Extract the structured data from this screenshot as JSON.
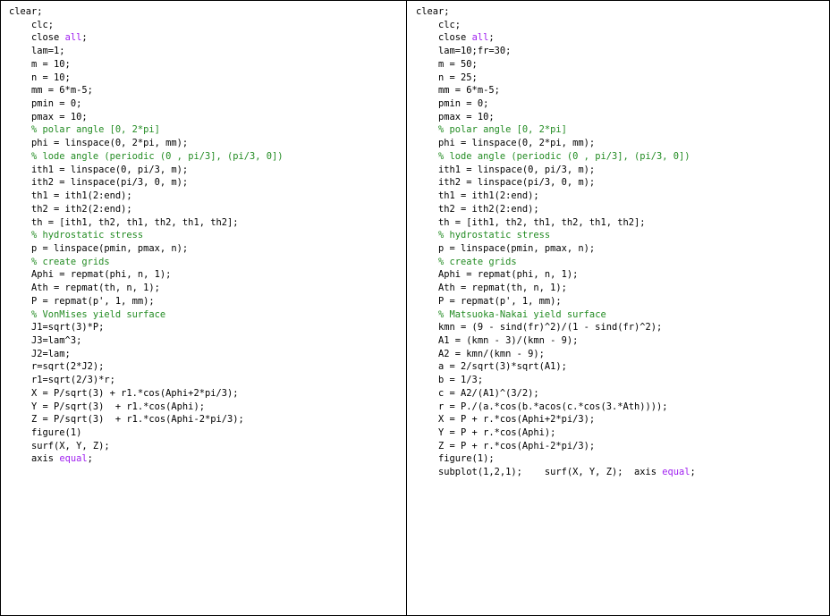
{
  "colors": {
    "keyword": "#a020f0",
    "comment": "#228b22",
    "text": "#000000",
    "border": "#000000",
    "background": "#ffffff"
  },
  "left_panel": {
    "lines": [
      [
        {
          "t": "clear;"
        }
      ],
      [
        {
          "t": "    clc;"
        }
      ],
      [
        {
          "t": "    close "
        },
        {
          "t": "all",
          "k": "kw"
        },
        {
          "t": ";"
        }
      ],
      [
        {
          "t": "    lam=1;"
        }
      ],
      [
        {
          "t": "    m = 10;"
        }
      ],
      [
        {
          "t": "    n = 10;"
        }
      ],
      [
        {
          "t": "    mm = 6*m-5;"
        }
      ],
      [
        {
          "t": "    pmin = 0;"
        }
      ],
      [
        {
          "t": "    pmax = 10;"
        }
      ],
      [
        {
          "t": "    "
        },
        {
          "t": "% polar angle [0, 2*pi]",
          "k": "cm"
        }
      ],
      [
        {
          "t": "    phi = linspace(0, 2*pi, mm);"
        }
      ],
      [
        {
          "t": "    "
        },
        {
          "t": "% lode angle (periodic (0 , pi/3], (pi/3, 0])",
          "k": "cm"
        }
      ],
      [
        {
          "t": "    ith1 = linspace(0, pi/3, m);"
        }
      ],
      [
        {
          "t": "    ith2 = linspace(pi/3, 0, m);"
        }
      ],
      [
        {
          "t": "    th1 = ith1(2:end);"
        }
      ],
      [
        {
          "t": "    th2 = ith2(2:end);"
        }
      ],
      [
        {
          "t": "    th = [ith1, th2, th1, th2, th1, th2];"
        }
      ],
      [
        {
          "t": "    "
        },
        {
          "t": "% hydrostatic stress",
          "k": "cm"
        }
      ],
      [
        {
          "t": "    p = linspace(pmin, pmax, n);"
        }
      ],
      [
        {
          "t": "    "
        },
        {
          "t": "% create grids",
          "k": "cm"
        }
      ],
      [
        {
          "t": "    Aphi = repmat(phi, n, 1);"
        }
      ],
      [
        {
          "t": "    Ath = repmat(th, n, 1);"
        }
      ],
      [
        {
          "t": "    P = repmat(p', 1, mm);"
        }
      ],
      [
        {
          "t": "    "
        },
        {
          "t": "% VonMises yield surface",
          "k": "cm"
        }
      ],
      [
        {
          "t": "    J1=sqrt(3)*P;"
        }
      ],
      [
        {
          "t": "    J3=lam^3;"
        }
      ],
      [
        {
          "t": "    J2=lam;"
        }
      ],
      [
        {
          "t": "    r=sqrt(2*J2);"
        }
      ],
      [
        {
          "t": "    r1=sqrt(2/3)*r;"
        }
      ],
      [
        {
          "t": "    X = P/sqrt(3) + r1.*cos(Aphi+2*pi/3);"
        }
      ],
      [
        {
          "t": "    Y = P/sqrt(3)  + r1.*cos(Aphi);"
        }
      ],
      [
        {
          "t": "    Z = P/sqrt(3)  + r1.*cos(Aphi-2*pi/3);"
        }
      ],
      [
        {
          "t": "    figure(1)"
        }
      ],
      [
        {
          "t": "    surf(X, Y, Z);"
        }
      ],
      [
        {
          "t": "    axis "
        },
        {
          "t": "equal",
          "k": "kw"
        },
        {
          "t": ";"
        }
      ]
    ]
  },
  "right_panel": {
    "lines": [
      [
        {
          "t": "clear;"
        }
      ],
      [
        {
          "t": "    clc;"
        }
      ],
      [
        {
          "t": "    close "
        },
        {
          "t": "all",
          "k": "kw"
        },
        {
          "t": ";"
        }
      ],
      [
        {
          "t": "    lam=10;fr=30;"
        }
      ],
      [
        {
          "t": "    m = 50;"
        }
      ],
      [
        {
          "t": "    n = 25;"
        }
      ],
      [
        {
          "t": "    mm = 6*m-5;"
        }
      ],
      [
        {
          "t": "    pmin = 0;"
        }
      ],
      [
        {
          "t": "    pmax = 10;"
        }
      ],
      [
        {
          "t": "    "
        },
        {
          "t": "% polar angle [0, 2*pi]",
          "k": "cm"
        }
      ],
      [
        {
          "t": "    phi = linspace(0, 2*pi, mm);"
        }
      ],
      [
        {
          "t": "    "
        },
        {
          "t": "% lode angle (periodic (0 , pi/3], (pi/3, 0])",
          "k": "cm"
        }
      ],
      [
        {
          "t": "    ith1 = linspace(0, pi/3, m);"
        }
      ],
      [
        {
          "t": "    ith2 = linspace(pi/3, 0, m);"
        }
      ],
      [
        {
          "t": "    th1 = ith1(2:end);"
        }
      ],
      [
        {
          "t": "    th2 = ith2(2:end);"
        }
      ],
      [
        {
          "t": "    th = [ith1, th2, th1, th2, th1, th2];"
        }
      ],
      [
        {
          "t": "    "
        },
        {
          "t": "% hydrostatic stress",
          "k": "cm"
        }
      ],
      [
        {
          "t": "    p = linspace(pmin, pmax, n);"
        }
      ],
      [
        {
          "t": "    "
        },
        {
          "t": "% create grids",
          "k": "cm"
        }
      ],
      [
        {
          "t": "    Aphi = repmat(phi, n, 1);"
        }
      ],
      [
        {
          "t": "    Ath = repmat(th, n, 1);"
        }
      ],
      [
        {
          "t": "    P = repmat(p', 1, mm);"
        }
      ],
      [
        {
          "t": "    "
        },
        {
          "t": "% Matsuoka-Nakai yield surface",
          "k": "cm"
        }
      ],
      [
        {
          "t": "    kmn = (9 - sind(fr)^2)/(1 - sind(fr)^2);"
        }
      ],
      [
        {
          "t": "    A1 = (kmn - 3)/(kmn - 9);"
        }
      ],
      [
        {
          "t": "    A2 = kmn/(kmn - 9);"
        }
      ],
      [
        {
          "t": "    a = 2/sqrt(3)*sqrt(A1);"
        }
      ],
      [
        {
          "t": "    b = 1/3;"
        }
      ],
      [
        {
          "t": "    c = A2/(A1)^(3/2);"
        }
      ],
      [
        {
          "t": "    r = P./(a.*cos(b.*acos(c.*cos(3.*Ath))));"
        }
      ],
      [
        {
          "t": "    X = P + r.*cos(Aphi+2*pi/3);"
        }
      ],
      [
        {
          "t": "    Y = P + r.*cos(Aphi);"
        }
      ],
      [
        {
          "t": "    Z = P + r.*cos(Aphi-2*pi/3);"
        }
      ],
      [
        {
          "t": "    figure(1);"
        }
      ],
      [
        {
          "t": "    subplot(1,2,1);    surf(X, Y, Z);  axis "
        },
        {
          "t": "equal",
          "k": "kw"
        },
        {
          "t": ";"
        }
      ]
    ]
  }
}
